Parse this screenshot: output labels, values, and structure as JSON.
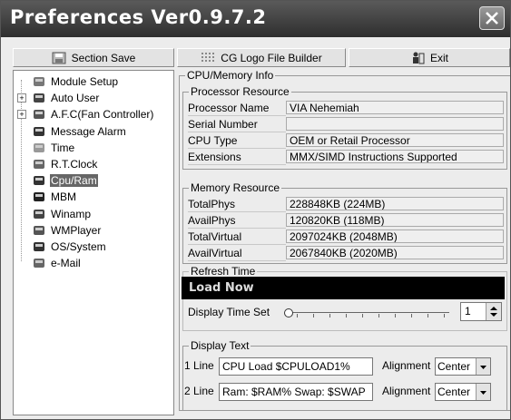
{
  "window": {
    "title": "Preferences Ver0.9.7.2"
  },
  "toolbar": {
    "section_save": "Section Save",
    "logo_builder": "CG Logo File Builder",
    "exit": "Exit"
  },
  "tree": {
    "items": [
      {
        "label": "Module Setup",
        "icon": "module-setup-icon"
      },
      {
        "label": "Auto User",
        "icon": "users-icon"
      },
      {
        "label": "A.F.C(Fan Controller)",
        "icon": "fan-icon"
      },
      {
        "label": "Message Alarm",
        "icon": "message-alarm-icon"
      },
      {
        "label": "Time",
        "icon": "clock-icon"
      },
      {
        "label": "R.T.Clock",
        "icon": "rtclock-icon"
      },
      {
        "label": "Cpu/Ram",
        "icon": "cpu-icon",
        "selected": true
      },
      {
        "label": "MBM",
        "icon": "mbm-icon"
      },
      {
        "label": "Winamp",
        "icon": "winamp-icon"
      },
      {
        "label": "WMPlayer",
        "icon": "wmplayer-icon"
      },
      {
        "label": "OS/System",
        "icon": "os-system-icon"
      },
      {
        "label": "e-Mail",
        "icon": "email-icon"
      }
    ]
  },
  "cpu_memory": {
    "title": "CPU/Memory Info",
    "processor": {
      "title": "Processor Resource",
      "rows": [
        {
          "label": "Processor Name",
          "value": "VIA Nehemiah"
        },
        {
          "label": "Serial Number",
          "value": ""
        },
        {
          "label": "CPU Type",
          "value": "OEM or Retail Processor"
        },
        {
          "label": "Extensions",
          "value": "MMX/SIMD Instructions Supported"
        }
      ]
    },
    "memory": {
      "title": "Memory Resource",
      "rows": [
        {
          "label": "TotalPhys",
          "value": "228848KB (224MB)"
        },
        {
          "label": "AvailPhys",
          "value": "120820KB (118MB)"
        },
        {
          "label": "TotalVirtual",
          "value": "2097024KB (2048MB)"
        },
        {
          "label": "AvailVirtual",
          "value": "2067840KB (2020MB)"
        }
      ]
    }
  },
  "refresh": {
    "title": "Refresh Time",
    "lcd_text": "Load Now",
    "display_time_label": "Display Time Set",
    "display_time_value": "1"
  },
  "display_text": {
    "title": "Display Text",
    "lines": [
      {
        "label": "1 Line",
        "value": "CPU Load $CPULOAD1%",
        "alignment_label": "Alignment",
        "alignment": "Center"
      },
      {
        "label": "2 Line",
        "value": "Ram: $RAM% Swap: $SWAP",
        "alignment_label": "Alignment",
        "alignment": "Center"
      }
    ]
  }
}
